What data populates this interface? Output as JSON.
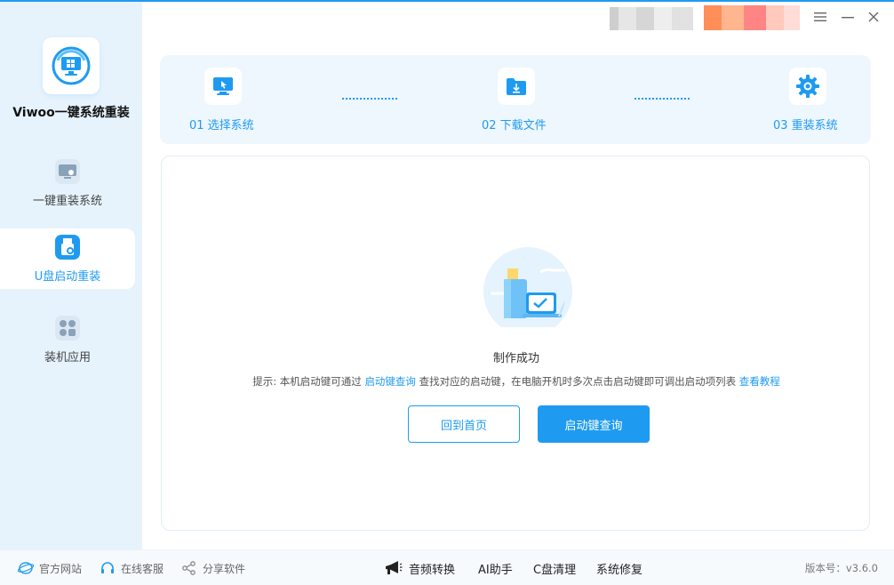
{
  "app": {
    "title": "Viwoo一键系统重装"
  },
  "sidebar": {
    "items": [
      {
        "label": "一键重装系统",
        "icon": "monitor-icon",
        "active": false
      },
      {
        "label": "U盘启动重装",
        "icon": "usb-icon",
        "active": true
      },
      {
        "label": "装机应用",
        "icon": "apps-icon",
        "active": false
      }
    ]
  },
  "titlebar": {
    "menu_icon": "menu-icon",
    "minimize_icon": "minimize-icon",
    "close_icon": "close-icon"
  },
  "steps": [
    {
      "label": "01 选择系统",
      "icon": "monitor-cursor-icon"
    },
    {
      "label": "02 下载文件",
      "icon": "folder-download-icon"
    },
    {
      "label": "03 重装系统",
      "icon": "gear-icon"
    }
  ],
  "main": {
    "status": "制作成功",
    "hint_prefix": "提示: 本机启动键可通过",
    "hint_link1": "启动键查询",
    "hint_middle": "查找对应的启动键，在电脑开机时多次点击启动键即可调出启动项列表",
    "hint_link2": "查看教程",
    "btn_home": "回到首页",
    "btn_query": "启动键查询"
  },
  "footer": {
    "official_site": "官方网站",
    "online_support": "在线客服",
    "share": "分享软件",
    "audio_convert": "音频转换",
    "ai_assistant": "AI助手",
    "c_clean": "C盘清理",
    "system_repair": "系统修复",
    "version": "版本号：v3.6.0"
  },
  "colors": {
    "accent": "#1e9bf0",
    "sidebar_bg": "#e6f3fd",
    "steps_bg": "#eef6fe"
  }
}
